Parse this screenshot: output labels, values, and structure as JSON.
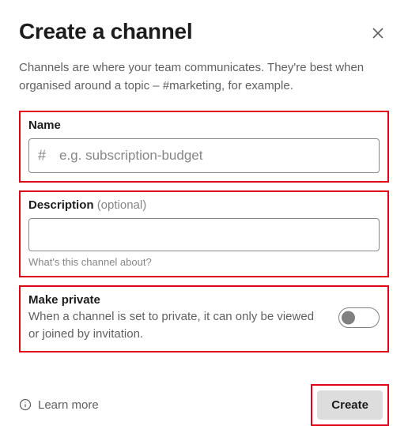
{
  "header": {
    "title": "Create a channel"
  },
  "intro": "Channels are where your team communicates. They're best when organised around a topic – #marketing, for example.",
  "name_field": {
    "label": "Name",
    "prefix": "#",
    "placeholder": "e.g. subscription-budget",
    "value": ""
  },
  "description_field": {
    "label": "Description",
    "optional_text": "(optional)",
    "value": "",
    "hint": "What's this channel about?"
  },
  "private": {
    "heading": "Make private",
    "description": "When a channel is set to private, it can only be viewed or joined by invitation.",
    "enabled": false
  },
  "footer": {
    "learn_more": "Learn more",
    "create": "Create"
  }
}
